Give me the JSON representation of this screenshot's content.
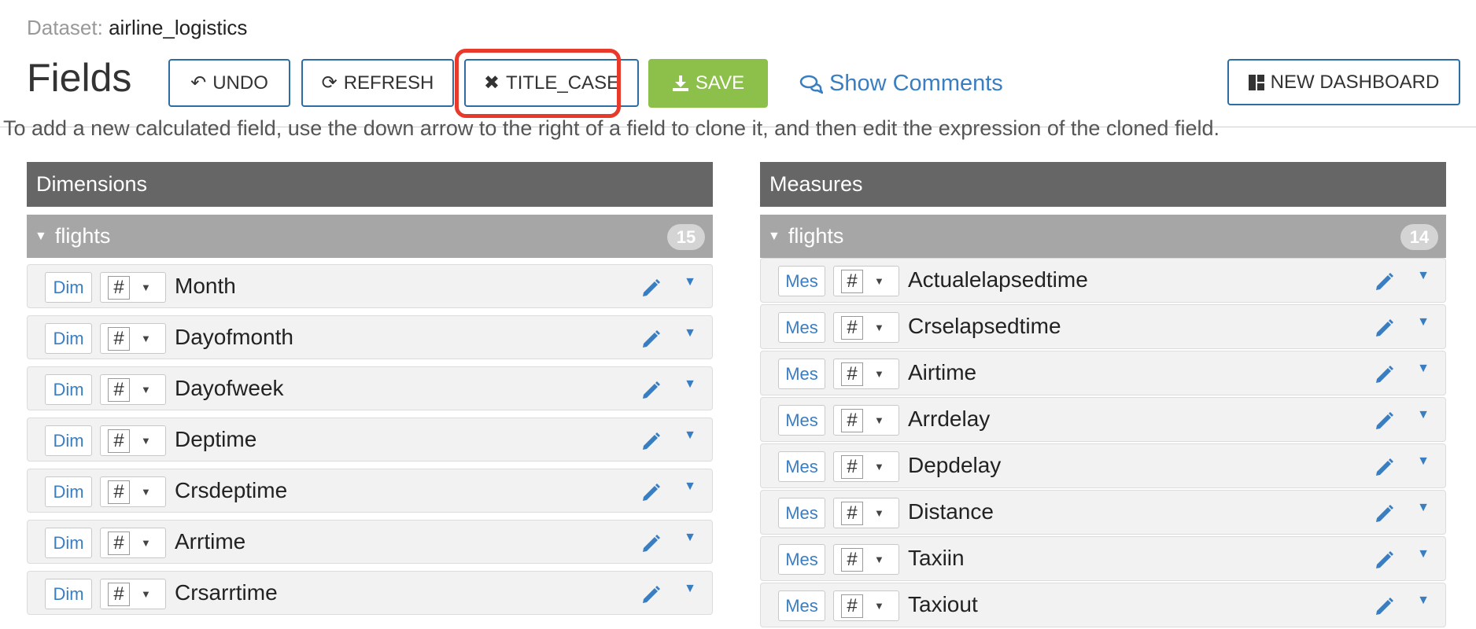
{
  "header": {
    "dataset_label": "Dataset:",
    "dataset_name": "airline_logistics",
    "title": "Fields"
  },
  "toolbar": {
    "undo": "UNDO",
    "refresh": "REFRESH",
    "title_case": "TITLE_CASE",
    "save": "SAVE",
    "show_comments": "Show Comments",
    "new_dashboard": "NEW DASHBOARD"
  },
  "info_text": "To add a new calculated field, use the down arrow to the right of a field to clone it, and then edit the expression of the cloned field.",
  "dimensions": {
    "title": "Dimensions",
    "group": {
      "name": "flights",
      "count": "15"
    },
    "tag": "Dim",
    "type_symbol": "#",
    "fields": [
      "Month",
      "Dayofmonth",
      "Dayofweek",
      "Deptime",
      "Crsdeptime",
      "Arrtime",
      "Crsarrtime"
    ]
  },
  "measures": {
    "title": "Measures",
    "group": {
      "name": "flights",
      "count": "14"
    },
    "tag": "Mes",
    "type_symbol": "#",
    "fields": [
      "Actualelapsedtime",
      "Crselapsedtime",
      "Airtime",
      "Arrdelay",
      "Depdelay",
      "Distance",
      "Taxiin",
      "Taxiout"
    ]
  },
  "colors": {
    "accent": "#3a7ec2",
    "save_green": "#8cc04b",
    "panel_header": "#666666",
    "group_header": "#a6a6a6",
    "highlight": "#e8392a"
  },
  "icons": {
    "undo": "undo-icon",
    "refresh": "refresh-icon",
    "title_case": "close-icon",
    "save": "download-icon",
    "comments": "comments-icon",
    "new_dashboard": "dashboard-grid-icon",
    "edit": "pencil-icon"
  }
}
